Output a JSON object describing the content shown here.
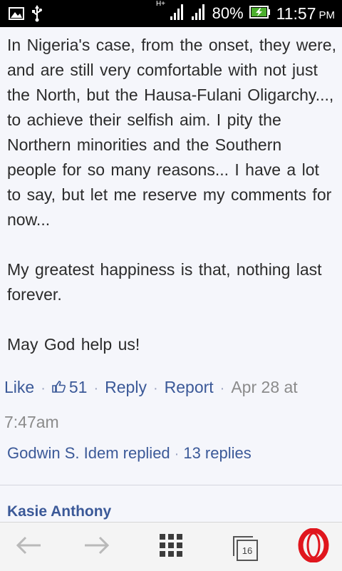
{
  "status_bar": {
    "network_type": "H+",
    "battery": "80%",
    "time": "11:57",
    "ampm": "PM",
    "icons": [
      "image-icon",
      "usb-icon",
      "signal-icon",
      "signal-icon",
      "battery-charging-icon"
    ]
  },
  "comment": {
    "paragraphs": [
      "In Nigeria's case, from the onset, they were, and are still very comfortable with not just the North, but the Hausa-Fulani Oligarchy..., to achieve their selfish aim. I pity the Northern minorities and the Southern people for so many reasons... I have a lot to say, but let me reserve my comments for now...",
      "My greatest happiness is that, nothing last forever.",
      "May God help us!"
    ],
    "like_label": "Like",
    "like_count": "51",
    "reply_label": "Reply",
    "report_label": "Report",
    "timestamp": "Apr 28 at 7:47am"
  },
  "replies": {
    "replied_by": "Godwin S. Idem replied",
    "count_label": "13 replies"
  },
  "next_comment": {
    "author": "Kasie Anthony"
  },
  "toolbar": {
    "tab_count": "16",
    "icons": [
      "back-arrow-icon",
      "forward-arrow-icon",
      "speed-dial-icon",
      "tabs-icon",
      "opera-menu-icon"
    ]
  },
  "colors": {
    "link": "#3b5998",
    "text": "#2b2b2b",
    "meta": "#8b8b8b",
    "background": "#f5f6fb",
    "opera_red": "#e0161d"
  }
}
